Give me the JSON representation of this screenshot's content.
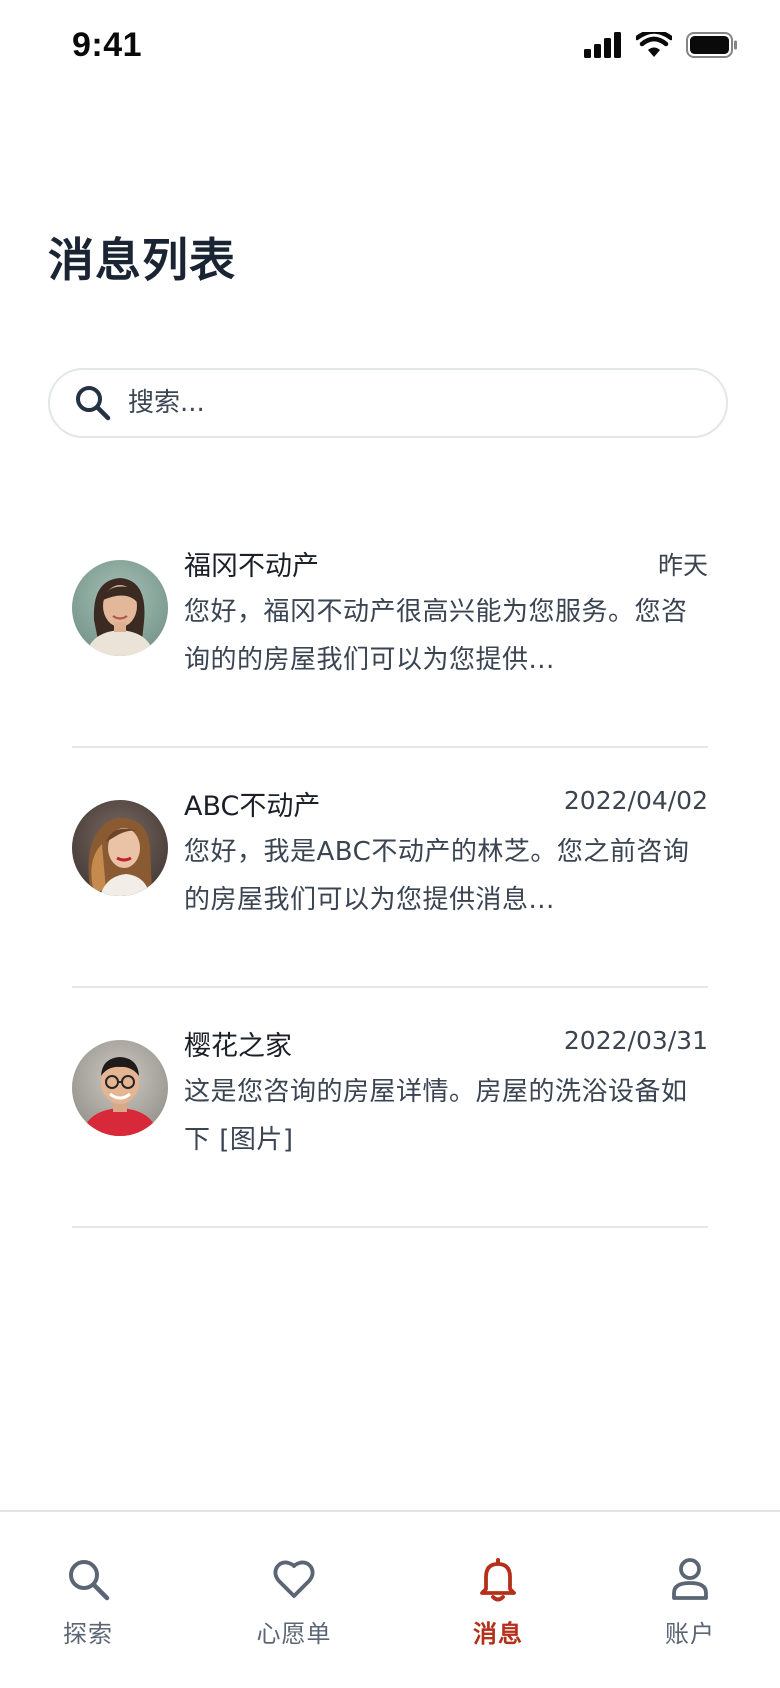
{
  "status_bar": {
    "time": "9:41"
  },
  "header": {
    "title": "消息列表"
  },
  "search": {
    "placeholder": "搜索..."
  },
  "messages": [
    {
      "name": "福冈不动产",
      "time": "昨天",
      "preview": "您好，福冈不动产很高兴能为您服务。您咨询的的房屋我们可以为您提供..."
    },
    {
      "name": "ABC不动产",
      "time": "2022/04/02",
      "preview": "您好，我是ABC不动产的林芝。您之前咨询的房屋我们可以为您提供消息..."
    },
    {
      "name": "樱花之家",
      "time": "2022/03/31",
      "preview": "这是您咨询的房屋详情。房屋的洗浴设备如下 [图片]"
    }
  ],
  "tab_bar": {
    "items": [
      {
        "label": "探索",
        "icon": "search-icon"
      },
      {
        "label": "心愿单",
        "icon": "heart-icon"
      },
      {
        "label": "消息",
        "icon": "bell-icon",
        "active": true
      },
      {
        "label": "账户",
        "icon": "user-icon"
      }
    ],
    "active_color": "#b5301a",
    "inactive_color": "#5b6574"
  }
}
